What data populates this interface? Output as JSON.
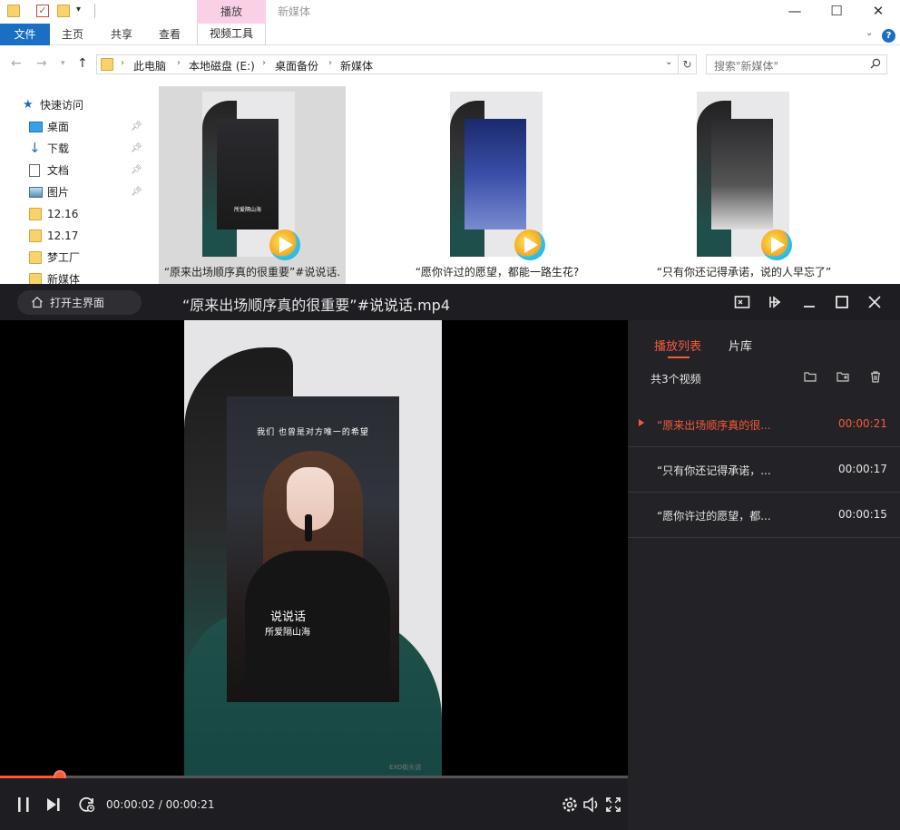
{
  "explorer": {
    "title": "新媒体",
    "contextual_tab_group": "播放",
    "ribbon_tabs": {
      "file": "文件",
      "home": "主页",
      "share": "共享",
      "view": "查看",
      "video_tools": "视频工具"
    },
    "window_controls": {
      "minimize": "—",
      "maximize": "☐",
      "close": "✕"
    },
    "breadcrumb": [
      "此电脑",
      "本地磁盘 (E:)",
      "桌面备份",
      "新媒体"
    ],
    "search_placeholder": "搜索\"新媒体\"",
    "nav_pane": {
      "quick_access": "快速访问",
      "items": [
        {
          "label": "桌面",
          "icon": "desktop-icon",
          "pinned": true
        },
        {
          "label": "下载",
          "icon": "download-icon",
          "pinned": true
        },
        {
          "label": "文档",
          "icon": "document-icon",
          "pinned": true
        },
        {
          "label": "图片",
          "icon": "picture-icon",
          "pinned": true
        },
        {
          "label": "12.16",
          "icon": "folder-icon",
          "pinned": false
        },
        {
          "label": "12.17",
          "icon": "folder-icon",
          "pinned": false
        },
        {
          "label": "梦工厂",
          "icon": "folder-icon",
          "pinned": false
        },
        {
          "label": "新媒体",
          "icon": "folder-icon",
          "pinned": false
        }
      ]
    },
    "files": [
      {
        "caption": "“原来出场顺序真的很重要”#说说话.",
        "selected": true,
        "inset_text": "所爱隔山海"
      },
      {
        "caption": "“愿你许过的愿望，都能一路生花?",
        "selected": false,
        "inset_text": ""
      },
      {
        "caption": "“只有你还记得承诺，说的人早忘了”",
        "selected": false,
        "inset_text": ""
      }
    ]
  },
  "player": {
    "open_main_label": "打开主界面",
    "title": "“原来出场顺序真的很重要”#说说话.mp4",
    "lyrics": {
      "top": "我们 也曾是对方唯一的希望",
      "title": "说说话",
      "subtitle": "所爱隔山海"
    },
    "watermark": "EXO街头说",
    "progress_fraction": 0.095,
    "time_readout": "00:00:02 / 00:00:21",
    "colors": {
      "accent": "#f55a3c",
      "background": "#1e1e22",
      "panel": "#232327"
    },
    "playlist": {
      "tab_playlist": "播放列表",
      "tab_library": "片库",
      "count_label": "共3个视频",
      "items": [
        {
          "title": "“原来出场顺序真的很...",
          "duration": "00:00:21",
          "active": true
        },
        {
          "title": "“只有你还记得承诺，...",
          "duration": "00:00:17",
          "active": false
        },
        {
          "title": "“愿你许过的愿望，都...",
          "duration": "00:00:15",
          "active": false
        }
      ]
    }
  }
}
